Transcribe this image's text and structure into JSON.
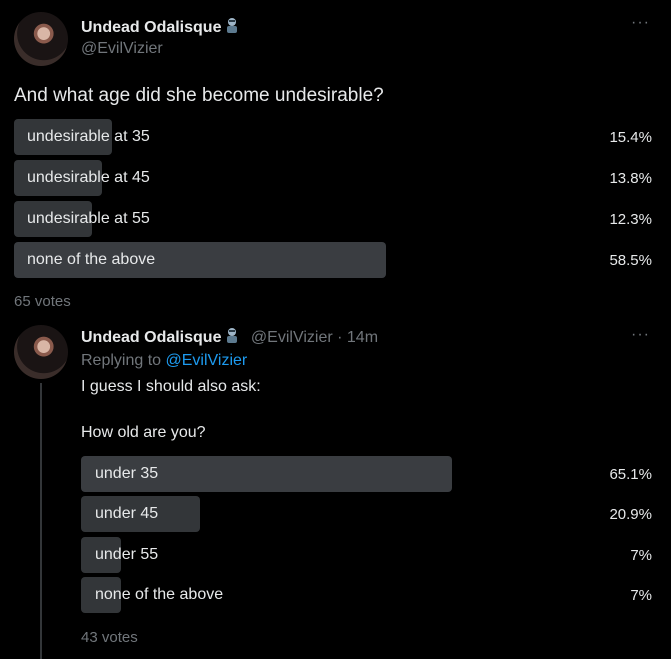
{
  "tweet1": {
    "author_name": "Undead Odalisque",
    "author_handle": "@EvilVizier",
    "more": "···",
    "text": "And what age did she become undesirable?",
    "poll": {
      "options": [
        {
          "label": "undesirable at 35",
          "percent_text": "15.4%",
          "percent": 15.4
        },
        {
          "label": "undesirable at 45",
          "percent_text": "13.8%",
          "percent": 13.8
        },
        {
          "label": "undesirable at 55",
          "percent_text": "12.3%",
          "percent": 12.3
        },
        {
          "label": "none of the above",
          "percent_text": "58.5%",
          "percent": 58.5
        }
      ],
      "votes": "65 votes"
    }
  },
  "tweet2": {
    "author_name": "Undead Odalisque",
    "author_handle": "@EvilVizier",
    "time": "· 14m",
    "more": "···",
    "replying_prefix": "Replying to ",
    "replying_handle": "@EvilVizier",
    "line1": "I guess I should also ask:",
    "line2": "How old are you?",
    "poll": {
      "options": [
        {
          "label": "under 35",
          "percent_text": "65.1%",
          "percent": 65.1
        },
        {
          "label": "under 45",
          "percent_text": "20.9%",
          "percent": 20.9
        },
        {
          "label": "under 55",
          "percent_text": "7%",
          "percent": 7
        },
        {
          "label": "none of the above",
          "percent_text": "7%",
          "percent": 7
        }
      ],
      "votes": "43 votes"
    }
  },
  "icons": {
    "author_emoji": "zombie-emoji-icon",
    "more": "more-options-icon"
  }
}
